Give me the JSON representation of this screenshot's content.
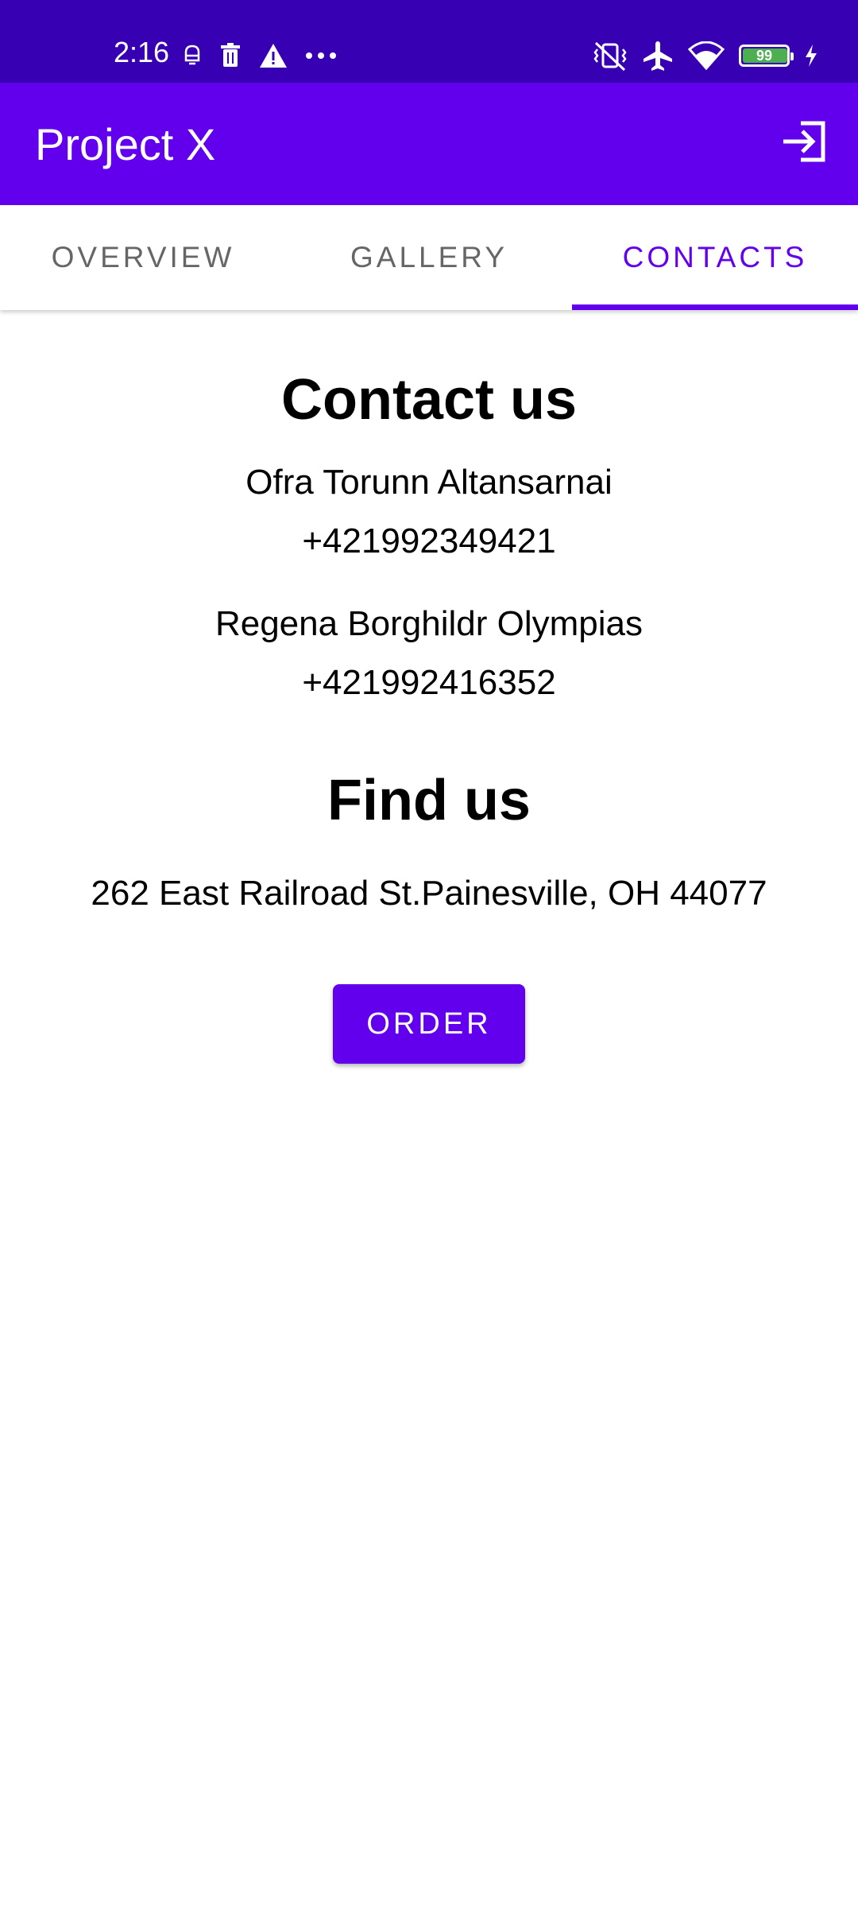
{
  "status_bar": {
    "time": "2:16",
    "battery_level": "99",
    "left_icons": [
      "notification-icon",
      "trash-icon",
      "warning-icon",
      "more-dots-icon"
    ],
    "right_icons": [
      "vibrate-off-icon",
      "airplane-icon",
      "wifi-icon",
      "battery-icon",
      "charging-icon"
    ]
  },
  "app_bar": {
    "title": "Project X",
    "action_icon": "login-icon"
  },
  "tabs": [
    {
      "label": "OVERVIEW",
      "active": false
    },
    {
      "label": "GALLERY",
      "active": false
    },
    {
      "label": "CONTACTS",
      "active": true
    }
  ],
  "contact": {
    "heading": "Contact us",
    "people": [
      {
        "name": "Ofra Torunn Altansarnai",
        "phone": "+421992349421"
      },
      {
        "name": "Regena Borghildr Olympias",
        "phone": "+421992416352"
      }
    ]
  },
  "find": {
    "heading": "Find us",
    "address": "262 East Railroad St.Painesville, OH 44077"
  },
  "order_button": {
    "label": "ORDER"
  },
  "colors": {
    "status_bar": "#3700b3",
    "primary": "#6200ee",
    "inactive_tab_text": "#666666",
    "battery_fill": "#4caf50"
  }
}
